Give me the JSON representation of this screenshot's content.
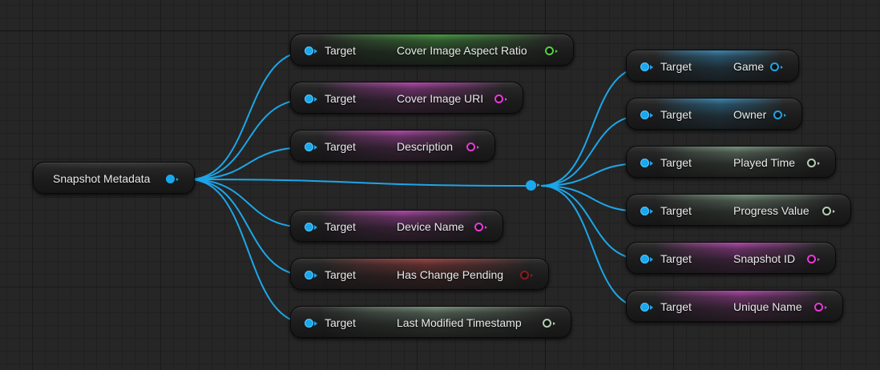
{
  "source": {
    "label": "Snapshot Metadata",
    "pin_color": "#19a8ee"
  },
  "wire_color": "#1ca6e8",
  "left_getters": [
    {
      "name": "getter-cover-image-aspect-ratio",
      "target_label": "Target",
      "output_label": "Cover Image Aspect Ratio",
      "tint_color": "#3fa83a",
      "pin_color": "#55d13f"
    },
    {
      "name": "getter-cover-image-uri",
      "target_label": "Target",
      "output_label": "Cover Image URI",
      "tint_color": "#c83fbf",
      "pin_color": "#e63ad8"
    },
    {
      "name": "getter-description",
      "target_label": "Target",
      "output_label": "Description",
      "tint_color": "#c83fbf",
      "pin_color": "#e63ad8"
    },
    {
      "name": "getter-device-name",
      "target_label": "Target",
      "output_label": "Device Name",
      "tint_color": "#c83fbf",
      "pin_color": "#e63ad8"
    },
    {
      "name": "getter-has-change-pending",
      "target_label": "Target",
      "output_label": "Has Change Pending",
      "tint_color": "#a83a3a",
      "pin_color": "#8a1c1c"
    },
    {
      "name": "getter-last-modified-timestamp",
      "target_label": "Target",
      "output_label": "Last Modified Timestamp",
      "tint_color": "#7f9e86",
      "pin_color": "#b5cdb5"
    }
  ],
  "right_getters": [
    {
      "name": "getter-game",
      "target_label": "Target",
      "output_label": "Game",
      "tint_color": "#2c8fc6",
      "pin_color": "#21a3e6"
    },
    {
      "name": "getter-owner",
      "target_label": "Target",
      "output_label": "Owner",
      "tint_color": "#2c8fc6",
      "pin_color": "#21a3e6"
    },
    {
      "name": "getter-played-time",
      "target_label": "Target",
      "output_label": "Played Time",
      "tint_color": "#7f9e86",
      "pin_color": "#b5cdb5"
    },
    {
      "name": "getter-progress-value",
      "target_label": "Target",
      "output_label": "Progress Value",
      "tint_color": "#7f9e86",
      "pin_color": "#b5cdb5"
    },
    {
      "name": "getter-snapshot-id",
      "target_label": "Target",
      "output_label": "Snapshot ID",
      "tint_color": "#c83fbf",
      "pin_color": "#e63ad8"
    },
    {
      "name": "getter-unique-name",
      "target_label": "Target",
      "output_label": "Unique Name",
      "tint_color": "#c83fbf",
      "pin_color": "#e63ad8"
    }
  ]
}
